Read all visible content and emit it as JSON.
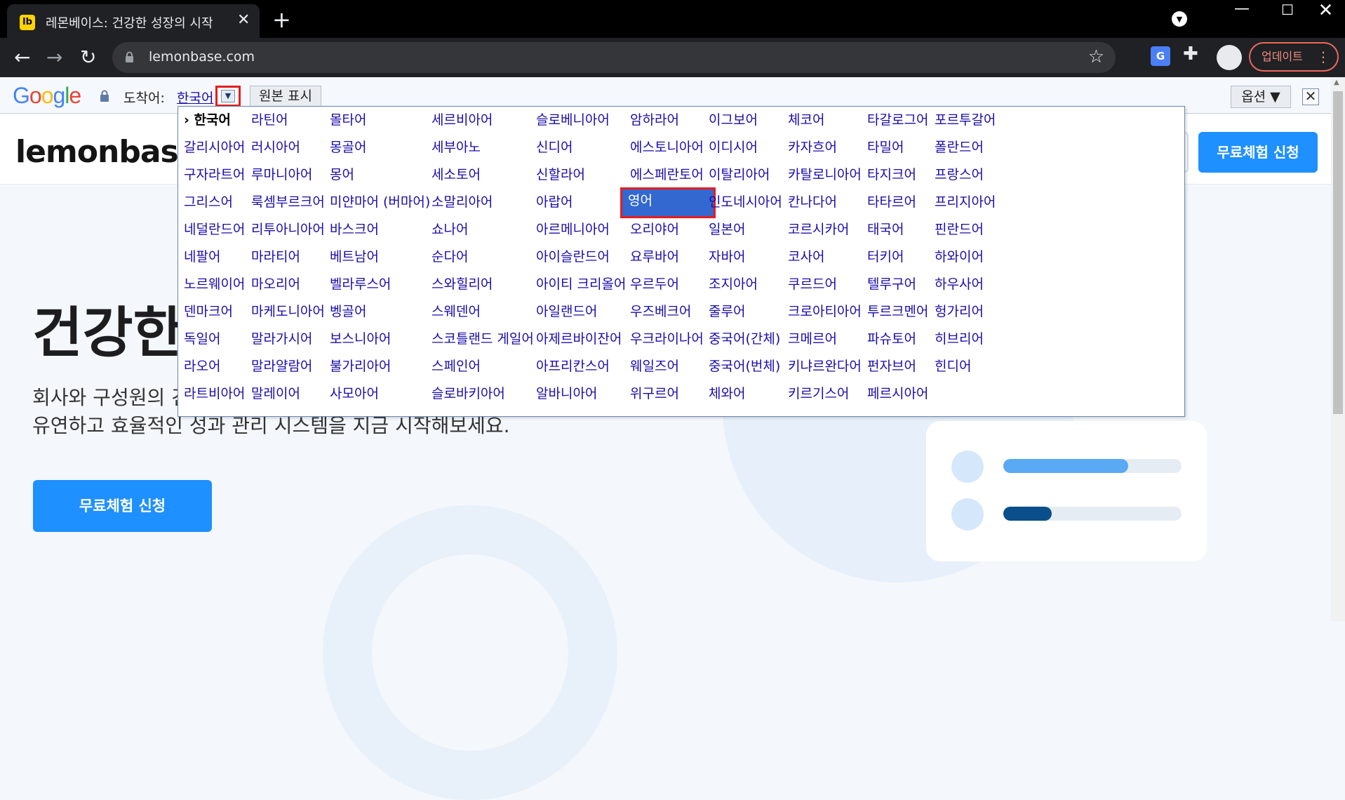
{
  "browser": {
    "tab_favicon": "lb",
    "tab_title": "레몬베이스: 건강한 성장의 시작",
    "tab_close": "✕",
    "new_tab": "+",
    "url": "lemonbase.com",
    "update_label": "업데이트"
  },
  "translate_bar": {
    "target_label": "도착어:",
    "target_lang": "한국어",
    "show_original": "원본 표시",
    "options": "옵션 ▼",
    "close": "✕"
  },
  "page": {
    "logo": "lemonbase",
    "header_cta": "무료체험 신청",
    "hero_title": "건강한",
    "hero_desc1": "회사와 구성원의 건",
    "hero_desc2": "유연하고 효율적인 성과 관리 시스템을 지금 시작해보세요.",
    "hero_cta": "무료체험 신청",
    "progress": [
      0.7,
      0.27
    ],
    "colors": {
      "accent": "#1e90ff",
      "bar1": "#5aa9f5",
      "bar2": "#0a4f8c"
    }
  },
  "languages": {
    "current": "› 한국어",
    "selected": "영어",
    "columns": [
      [
        "› 한국어",
        "갈리시아어",
        "구자라트어",
        "그리스어",
        "네덜란드어",
        "네팔어",
        "노르웨이어",
        "덴마크어",
        "독일어",
        "라오어",
        "라트비아어"
      ],
      [
        "라틴어",
        "러시아어",
        "루마니아어",
        "룩셈부르크어",
        "리투아니아어",
        "마라티어",
        "마오리어",
        "마케도니아어",
        "말라가시어",
        "말라얄람어",
        "말레이어"
      ],
      [
        "몰타어",
        "몽골어",
        "몽어",
        "미얀마어 (버마어)",
        "바스크어",
        "베트남어",
        "벨라루스어",
        "벵골어",
        "보스니아어",
        "불가리아어",
        "사모아어"
      ],
      [
        "세르비아어",
        "세부아노",
        "세소토어",
        "소말리아어",
        "쇼나어",
        "순다어",
        "스와힐리어",
        "스웨덴어",
        "스코틀랜드 게일어",
        "스페인어",
        "슬로바키아어"
      ],
      [
        "슬로베니아어",
        "신디어",
        "신할라어",
        "아랍어",
        "아르메니아어",
        "아이슬란드어",
        "아이티 크리올어",
        "아일랜드어",
        "아제르바이잔어",
        "아프리칸스어",
        "알바니아어"
      ],
      [
        "암하라어",
        "에스토니아어",
        "에스페란토어",
        "영어",
        "오리야어",
        "요루바어",
        "우르두어",
        "우즈베크어",
        "우크라이나어",
        "웨일즈어",
        "위구르어"
      ],
      [
        "이그보어",
        "이디시어",
        "이탈리아어",
        "인도네시아어",
        "일본어",
        "자바어",
        "조지아어",
        "줄루어",
        "중국어(간체)",
        "중국어(번체)",
        "체와어"
      ],
      [
        "체코어",
        "카자흐어",
        "카탈로니아어",
        "칸나다어",
        "코르시카어",
        "코사어",
        "쿠르드어",
        "크로아티아어",
        "크메르어",
        "키냐르완다어",
        "키르기스어"
      ],
      [
        "타갈로그어",
        "타밀어",
        "타지크어",
        "타타르어",
        "태국어",
        "터키어",
        "텔루구어",
        "투르크멘어",
        "파슈토어",
        "펀자브어",
        "페르시아어"
      ],
      [
        "포르투갈어",
        "폴란드어",
        "프랑스어",
        "프리지아어",
        "핀란드어",
        "하와이어",
        "하우사어",
        "헝가리어",
        "히브리어",
        "힌디어"
      ]
    ]
  }
}
